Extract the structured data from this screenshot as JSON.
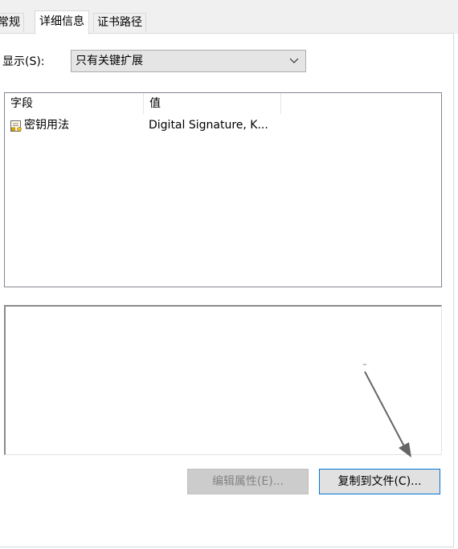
{
  "tabs": [
    {
      "label": "常规",
      "active": false
    },
    {
      "label": "详细信息",
      "active": true
    },
    {
      "label": "证书路径",
      "active": false
    }
  ],
  "show": {
    "label": "显示(S):",
    "selected": "只有关键扩展"
  },
  "list": {
    "columns": [
      "字段",
      "值"
    ],
    "rows": [
      {
        "field": "密钥用法",
        "value": "Digital Signature, K..."
      }
    ]
  },
  "buttons": {
    "edit_label": "编辑属性(E)...",
    "copy_label": "复制到文件(C)..."
  },
  "annotation": {
    "mark": "–",
    "color": "#666666"
  },
  "colors": {
    "accent": "#0078d7"
  }
}
